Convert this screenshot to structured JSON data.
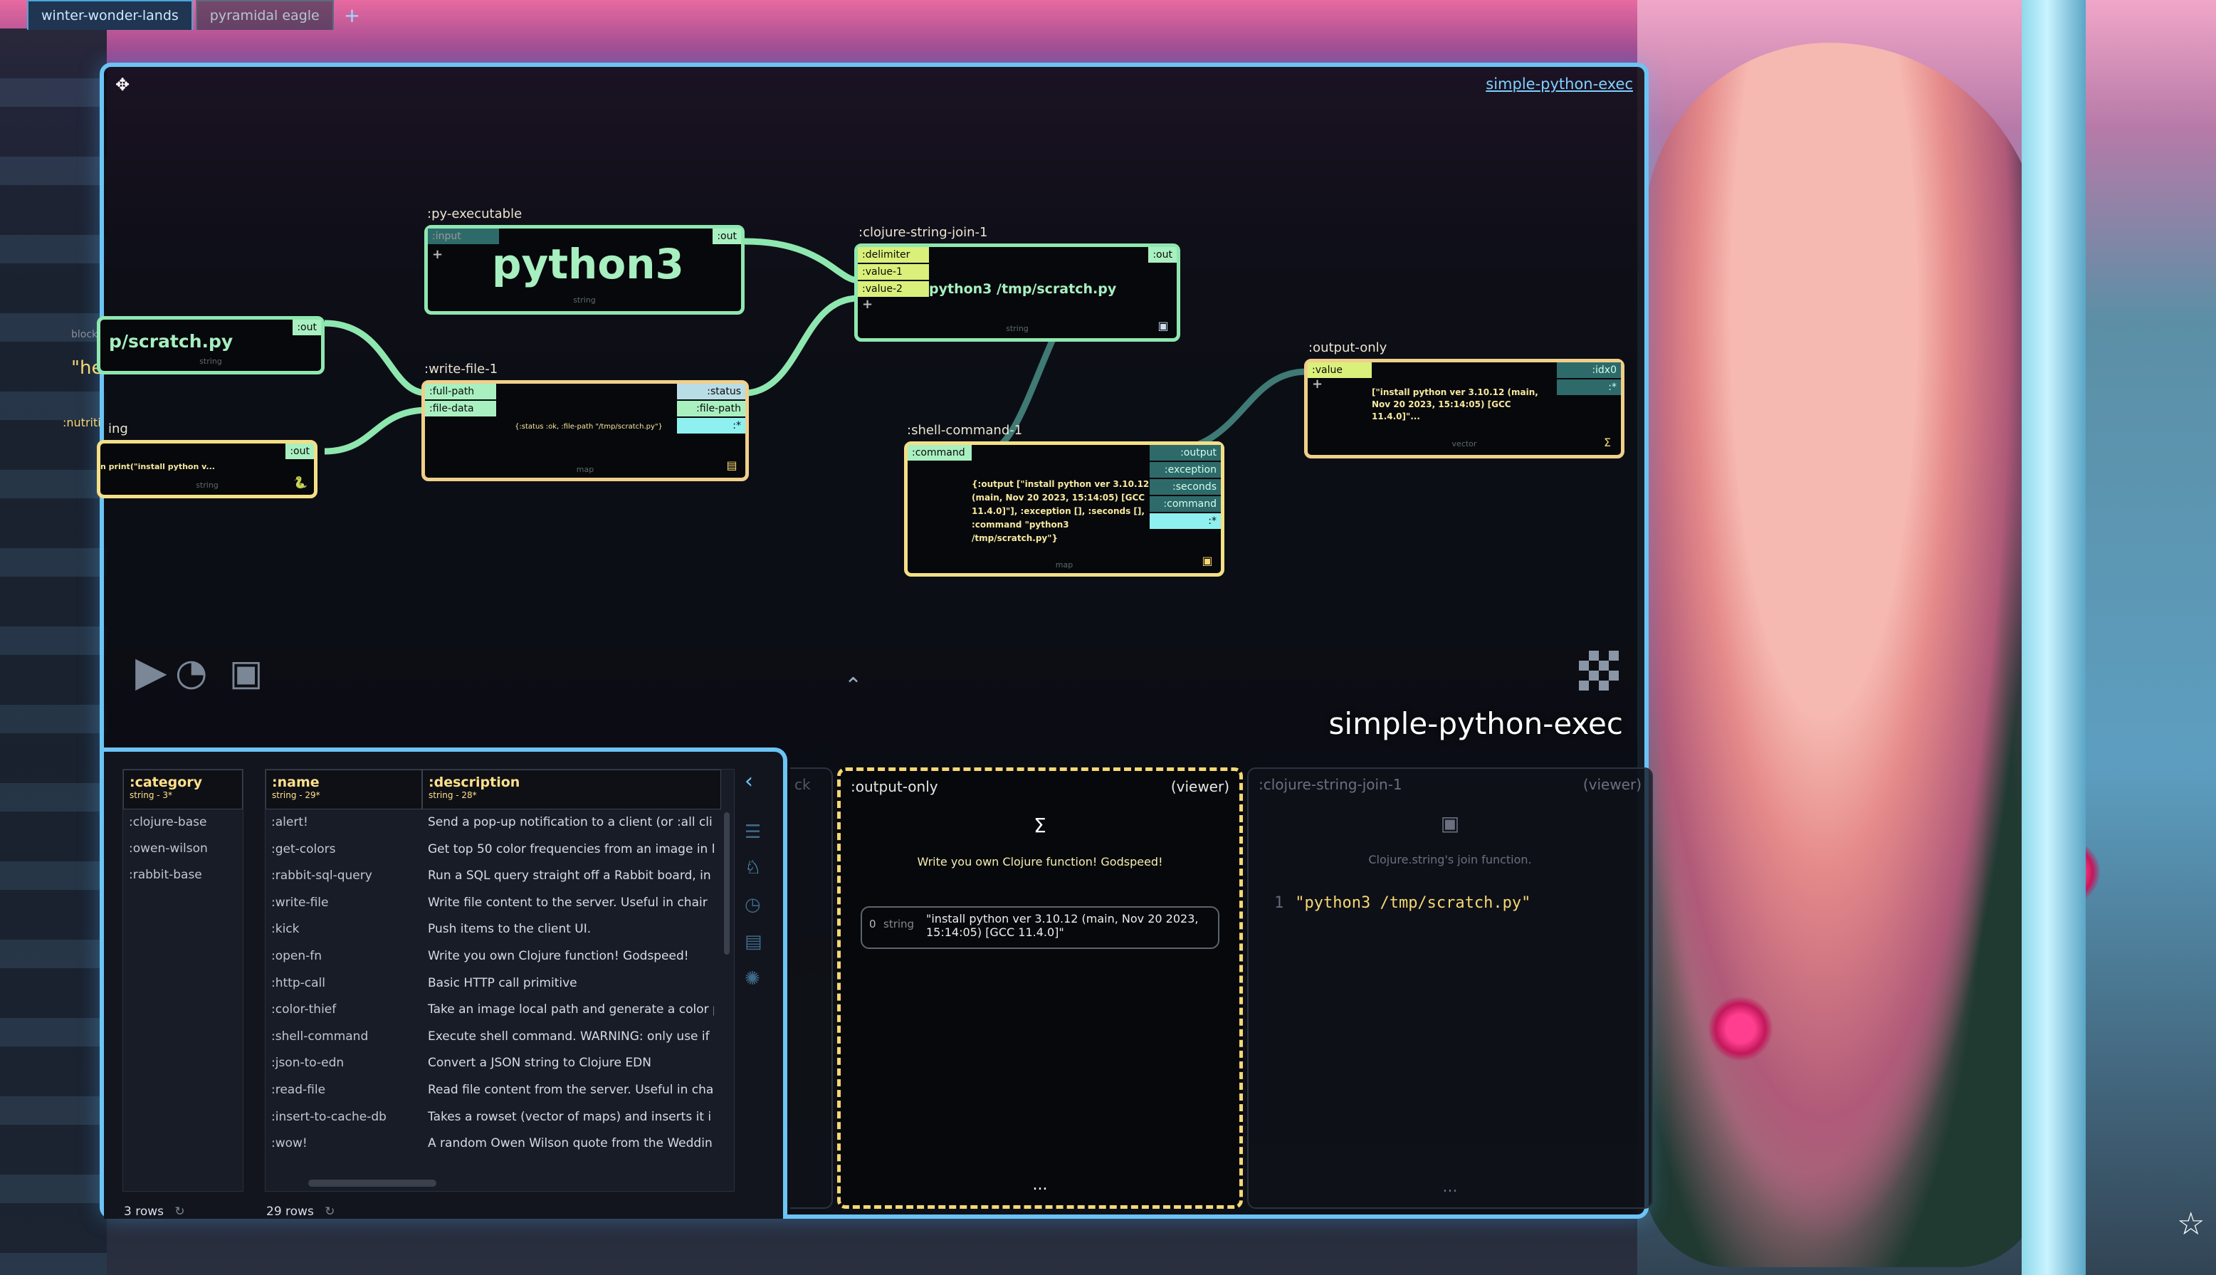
{
  "tabs": [
    {
      "label": "winter-wonder-lands"
    },
    {
      "label": "pyramidal eagle"
    }
  ],
  "tab_add": "+",
  "window": {
    "title": "simple-python-exec",
    "canvas_title": "simple-python-exec"
  },
  "nodes": {
    "py_exec": {
      "label": ":py-executable",
      "port_in": ":input",
      "port_out": ":out",
      "value": "python3",
      "type": "string",
      "plus": "+"
    },
    "scratch": {
      "value": "p/scratch.py",
      "port_out": ":out",
      "type": "string"
    },
    "nutrit": {
      "port_out": ":out",
      "value": "n print(\"install python v...",
      "type": "string"
    },
    "write_file": {
      "label": ":write-file-1",
      "ports_in": [
        ":full-path",
        ":file-data"
      ],
      "ports_out": [
        ":status",
        ":file-path",
        ":*"
      ],
      "text": "{:status :ok, :file-path \"/tmp/scratch.py\"}",
      "type": "map"
    },
    "join": {
      "label": ":clojure-string-join-1",
      "ports_in": [
        ":delimiter",
        ":value-1",
        ":value-2"
      ],
      "port_out": ":out",
      "value": "python3 /tmp/scratch.py",
      "type": "string",
      "plus": "+"
    },
    "shell": {
      "label": ":shell-command-1",
      "port_in": ":command",
      "ports_out": [
        ":output",
        ":exception",
        ":seconds",
        ":command",
        ":*"
      ],
      "text": "{:output [\"install python ver 3.10.12 (main, Nov 20 2023, 15:14:05) [GCC 11.4.0]\"], :exception [], :seconds [], :command \"python3 /tmp/scratch.py\"}",
      "type": "map"
    },
    "output_only": {
      "label": ":output-only",
      "port_in": ":value",
      "port_out": ":idx0",
      "port_out2": ":*",
      "text": "[\"install python ver 3.10.12 (main, Nov 20 2023, 15:14:05) [GCC 11.4.0]\"...",
      "type": "vector",
      "plus": "+"
    }
  },
  "ghost": {
    "block": "block-",
    "he": "\"he",
    "nutrit": ":nutriti",
    "ing": "ing"
  },
  "tables": {
    "category": {
      "header": ":category",
      "type": "string - 3*",
      "rows": [
        ":clojure-base",
        ":owen-wilson",
        ":rabbit-base"
      ],
      "count": "3 rows"
    },
    "functions": {
      "headers": [
        {
          "name": ":name",
          "type": "string - 29*"
        },
        {
          "name": ":description",
          "type": "string - 28*"
        }
      ],
      "rows": [
        [
          ":alert!",
          "Send a pop-up notification to a client (or :all cli"
        ],
        [
          ":get-colors",
          "Get top 50 color frequencies from an image in l"
        ],
        [
          ":rabbit-sql-query",
          "Run a SQL query straight off a Rabbit board, in"
        ],
        [
          ":write-file",
          "Write file content to the server. Useful in chair"
        ],
        [
          ":kick",
          "Push items to the client UI."
        ],
        [
          ":open-fn",
          "Write you own Clojure function! Godspeed!"
        ],
        [
          ":http-call",
          "Basic HTTP call primitive"
        ],
        [
          ":color-thief",
          "Take an image local path and generate a color p"
        ],
        [
          ":shell-command",
          "Execute shell command. WARNING: only use if"
        ],
        [
          ":json-to-edn",
          "Convert a JSON string to Clojure EDN"
        ],
        [
          ":read-file",
          "Read file content from the server. Useful in cha"
        ],
        [
          ":insert-to-cache-db",
          "Takes a rowset (vector of maps) and inserts it i"
        ],
        [
          ":wow!",
          "A random Owen Wilson quote from the Weddin"
        ]
      ],
      "count": "29 rows"
    }
  },
  "viewers": [
    {
      "title": ":output-only",
      "tag": "(viewer)",
      "sigma": "Σ",
      "desc": "Write you own Clojure function! Godspeed!",
      "index": "0",
      "type": "string",
      "value": "\"install python ver 3.10.12 (main, Nov 20 2023, 15:14:05) [GCC 11.4.0]\"",
      "dots": "..."
    },
    {
      "title": ":clojure-string-join-1",
      "tag": "(viewer)",
      "desc": "Clojure.string's join function.",
      "line": "1",
      "code": "\"python3 /tmp/scratch.py\"",
      "dots": "..."
    }
  ],
  "ghost_panel": {
    "ck": "ck"
  },
  "icons": [
    "move-icon",
    "play-icon",
    "history-icon",
    "save-icon",
    "chevron-up-icon",
    "grid-icon",
    "chevron-left-icon",
    "list-icon",
    "rabbit-icon",
    "clock-icon",
    "table-icon",
    "bug-icon",
    "refresh-icon",
    "star-icon",
    "python-icon",
    "file-icon",
    "sigma-icon"
  ],
  "colors": {
    "accent": "#6cc4f5",
    "port_green": "#a9f0c1",
    "port_lime": "#d9f07a",
    "node_yellow": "#f3df86",
    "wire": "#8fe7b0"
  }
}
